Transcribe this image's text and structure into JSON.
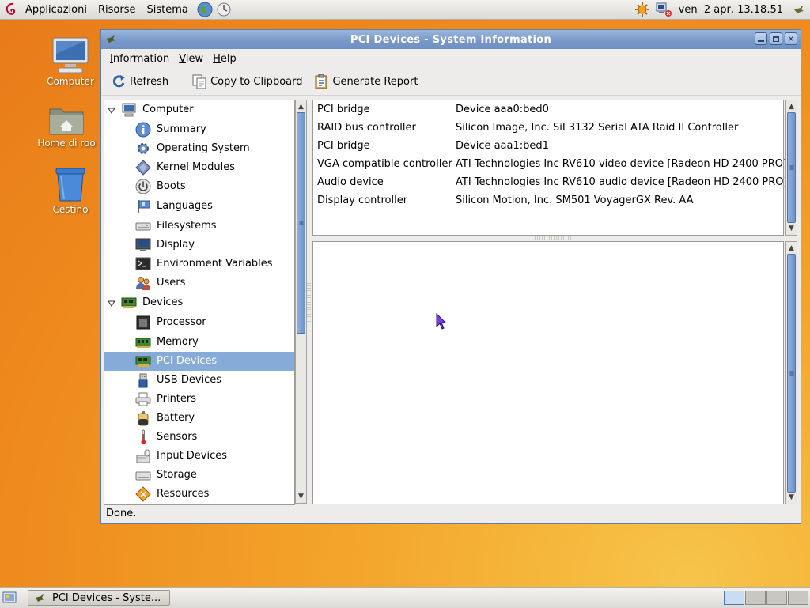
{
  "top_panel": {
    "menus": [
      "Applicazioni",
      "Risorse",
      "Sistema"
    ],
    "clock": "ven  2 apr, 13.18.51"
  },
  "desktop": {
    "icons": [
      {
        "label": "Computer",
        "icon": "computer-icon"
      },
      {
        "label": "Home di roo",
        "icon": "home-folder-icon"
      },
      {
        "label": "Cestino",
        "icon": "trash-icon"
      }
    ]
  },
  "window": {
    "title": "PCI Devices - System Information",
    "menubar": [
      {
        "first": "I",
        "rest": "nformation"
      },
      {
        "first": "V",
        "rest": "iew"
      },
      {
        "first": "H",
        "rest": "elp"
      }
    ],
    "toolbar": {
      "refresh": "Refresh",
      "copy": "Copy to Clipboard",
      "report": "Generate Report"
    },
    "tree": {
      "computer": {
        "label": "Computer",
        "items": [
          "Summary",
          "Operating System",
          "Kernel Modules",
          "Boots",
          "Languages",
          "Filesystems",
          "Display",
          "Environment Variables",
          "Users"
        ]
      },
      "devices": {
        "label": "Devices",
        "items": [
          "Processor",
          "Memory",
          "PCI Devices",
          "USB Devices",
          "Printers",
          "Battery",
          "Sensors",
          "Input Devices",
          "Storage",
          "Resources"
        ],
        "selected": "PCI Devices"
      }
    },
    "devices": [
      {
        "type": "PCI bridge",
        "name": "Device aaa0:bed0"
      },
      {
        "type": "RAID bus controller",
        "name": "Silicon Image, Inc. SiI 3132 Serial ATA Raid II Controller"
      },
      {
        "type": "PCI bridge",
        "name": "Device aaa1:bed1"
      },
      {
        "type": "VGA compatible controller",
        "name": "ATI Technologies Inc RV610 video device [Radeon HD 2400 PRO]"
      },
      {
        "type": "Audio device",
        "name": "ATI Technologies Inc RV610 audio device [Radeon HD 2400 PRO]"
      },
      {
        "type": "Display controller",
        "name": "Silicon Motion, Inc. SM501 VoyagerGX Rev. AA"
      }
    ],
    "status": "Done."
  },
  "taskbar": {
    "task": "PCI Devices - Syste..."
  },
  "colors": {
    "selection": "#86abd9",
    "titlebar": "#7899c8",
    "desktop": "#ee8a1e"
  }
}
